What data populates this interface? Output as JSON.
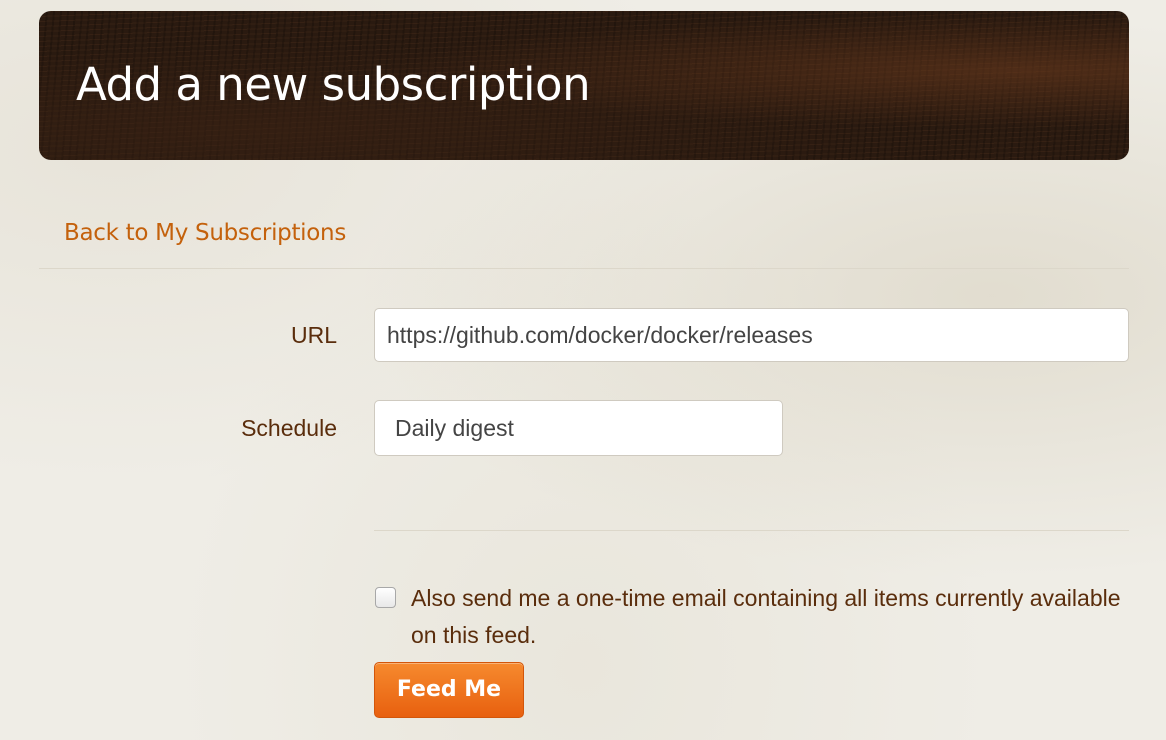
{
  "header": {
    "title": "Add a new subscription"
  },
  "nav": {
    "back_link": "Back to My Subscriptions"
  },
  "form": {
    "url_label": "URL",
    "url_value": "https://github.com/docker/docker/releases",
    "schedule_label": "Schedule",
    "schedule_value": "Daily digest",
    "checkbox_checked": false,
    "checkbox_label": "Also send me a one-time email containing all items currently available on this feed.",
    "submit_label": "Feed Me"
  },
  "colors": {
    "link": "#c4610c",
    "label_text": "#5a2d0c",
    "button": "#f07020",
    "header_bg": "#2a1a10"
  }
}
